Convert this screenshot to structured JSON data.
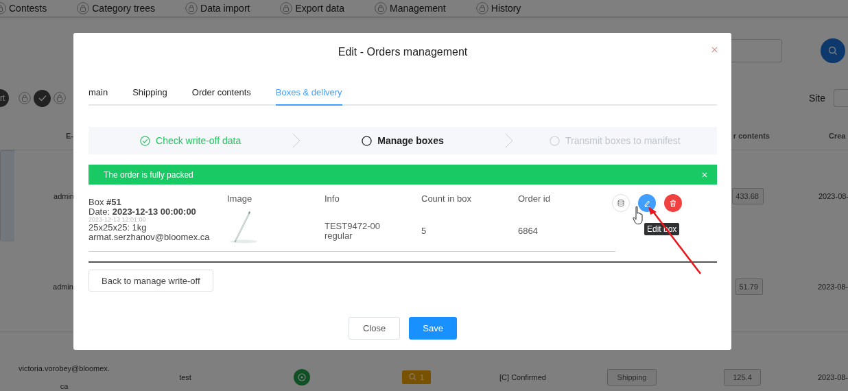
{
  "nav": [
    "Contests",
    "Category trees",
    "Data import",
    "Export data",
    "Management",
    "History"
  ],
  "toolbar": {
    "button": "rt",
    "site_label": "Site"
  },
  "table": {
    "column_1": "E-",
    "column_7": "r contents",
    "column_8": "Crea",
    "rows": [
      {
        "selected": true,
        "column_1": "admin",
        "column_7": "433.68",
        "column_8": "2023-08-"
      },
      {
        "selected": false,
        "column_1": "admin",
        "column_7": "51.79",
        "column_8": "2023-08-"
      },
      {
        "selected": false,
        "column_1": "victoria.vorobey@bloomex.ca",
        "column_2": "test",
        "column_4": "1",
        "column_5": "[C] Confirmed",
        "column_6": "Shipping",
        "column_7": "125.4",
        "column_8": "2023-08-"
      }
    ]
  },
  "modal": {
    "title": "Edit - Orders management",
    "tabs": [
      {
        "label": "main",
        "selected": false
      },
      {
        "label": "Shipping",
        "selected": false
      },
      {
        "label": "Order contents",
        "selected": false
      },
      {
        "label": "Boxes & delivery",
        "selected": true
      }
    ],
    "steps": [
      {
        "label": "Check write-off data",
        "completed": true,
        "active": false
      },
      {
        "label": "Manage boxes",
        "completed": false,
        "active": true
      },
      {
        "label": "Transmit boxes to manifest",
        "completed": false,
        "active": false
      }
    ],
    "alert": {
      "text": "The order is fully packed"
    },
    "box": {
      "title": "Box **#51**",
      "date": "Date: **2023-12-13 00:00:00**",
      "timestamp": "2023-12-13 12:01:00",
      "size": "25x25x25: 1kg",
      "email": "armat.serzhanov@bloomex.ca"
    },
    "columns": [
      "Image",
      "Info",
      "Count in box",
      "Order id"
    ],
    "items": [
      {
        "info": [
          "TEST9472-00",
          "regular"
        ],
        "count": "5",
        "order_id": "6864"
      }
    ],
    "tooltip": "Edit box",
    "back_button": "Back to manage write-off",
    "footer_buttons": [
      {
        "label": "Close",
        "kind": "plain"
      },
      {
        "label": "Save",
        "kind": "primary"
      }
    ]
  }
}
